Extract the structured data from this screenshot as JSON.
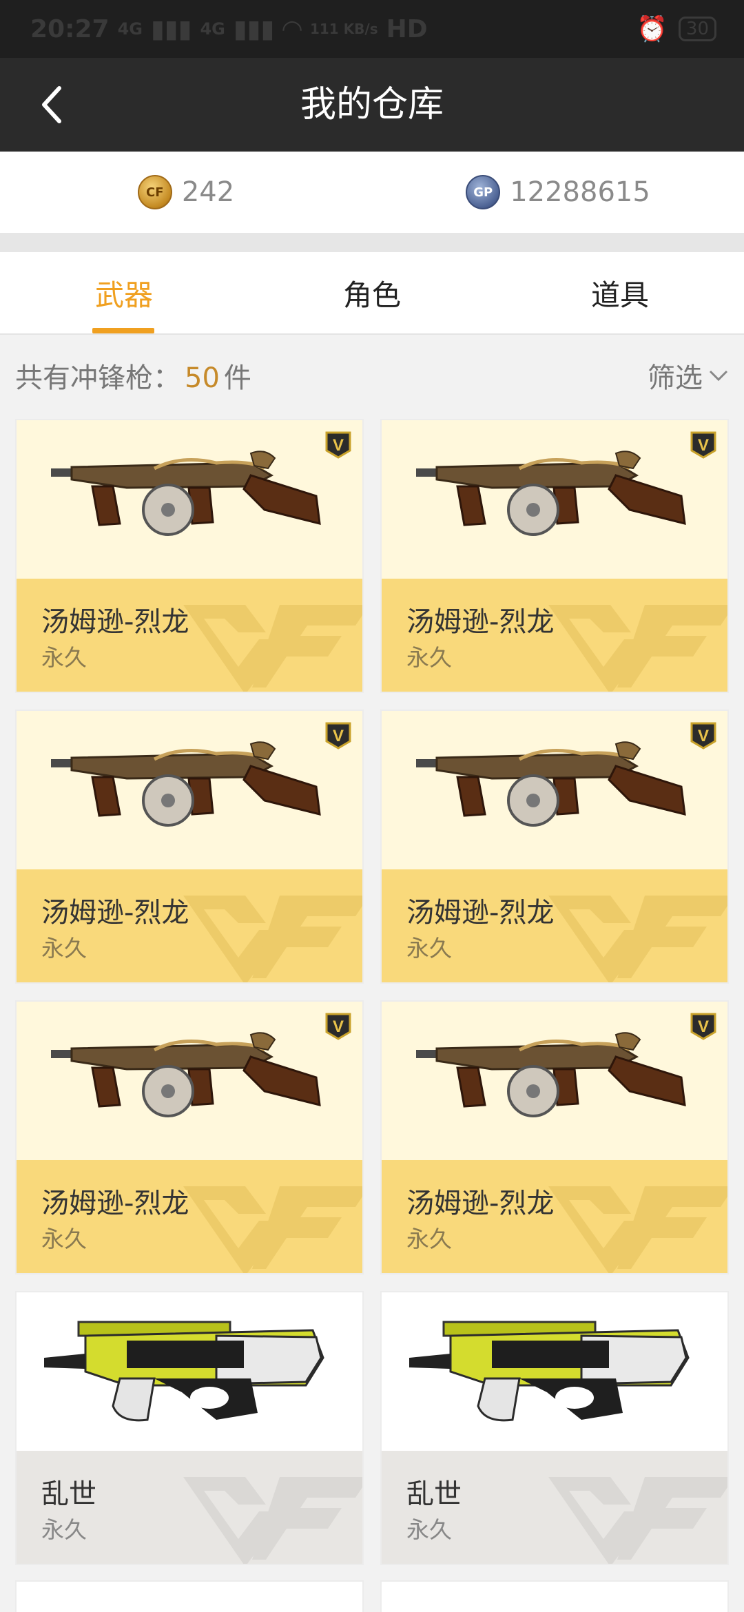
{
  "status": {
    "time": "20:27",
    "signal1": "4G",
    "signal2": "4G",
    "speed": "111 KB/s",
    "hd": "HD",
    "battery": "30"
  },
  "header": {
    "title": "我的仓库"
  },
  "currency": [
    {
      "icon": "cf-coin-icon",
      "value": "242"
    },
    {
      "icon": "gp-coin-icon",
      "value": "12288615"
    }
  ],
  "tabs": [
    {
      "label": "武器",
      "active": true
    },
    {
      "label": "角色",
      "active": false
    },
    {
      "label": "道具",
      "active": false
    }
  ],
  "summary": {
    "prefix": "共有冲锋枪：",
    "count": "50",
    "suffix": "件",
    "filter_label": "筛选"
  },
  "items": [
    {
      "name": "汤姆逊-烈龙",
      "duration": "永久",
      "rarity": "gold",
      "vip": true
    },
    {
      "name": "汤姆逊-烈龙",
      "duration": "永久",
      "rarity": "gold",
      "vip": true
    },
    {
      "name": "汤姆逊-烈龙",
      "duration": "永久",
      "rarity": "gold",
      "vip": true
    },
    {
      "name": "汤姆逊-烈龙",
      "duration": "永久",
      "rarity": "gold",
      "vip": true
    },
    {
      "name": "汤姆逊-烈龙",
      "duration": "永久",
      "rarity": "gold",
      "vip": true
    },
    {
      "name": "汤姆逊-烈龙",
      "duration": "永久",
      "rarity": "gold",
      "vip": true
    },
    {
      "name": "乱世",
      "duration": "永久",
      "rarity": "silver",
      "vip": false
    },
    {
      "name": "乱世",
      "duration": "永久",
      "rarity": "silver",
      "vip": false
    }
  ],
  "colors": {
    "accent": "#f0a020",
    "header_bg": "#2b2b2b",
    "gold_card": "#f9d97b",
    "silver_card": "#e8e6e3"
  }
}
